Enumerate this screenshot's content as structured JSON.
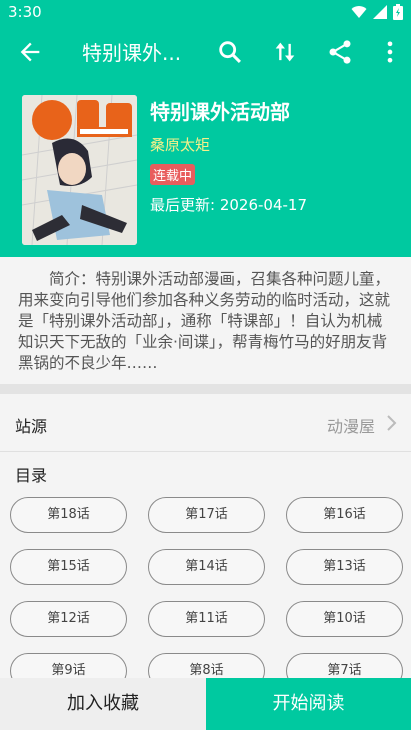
{
  "status_bar": {
    "time": "3:30"
  },
  "toolbar": {
    "title": "特别课外..."
  },
  "comic": {
    "title": "特别课外活动部",
    "author": "桑原太矩",
    "status": "连载中",
    "update_label": "最后更新:",
    "update_date": "2026-04-17",
    "intro": "简介：特别课外活动部漫画，召集各种问题儿童，用来变向引导他们参加各种义务劳动的临时活动，这就是「特别课外活动部」，通称「特课部」！自认为机械知识天下无敌的「业余·间谍」，帮青梅竹马的好朋友背黑锅的不良少年……"
  },
  "source": {
    "label": "站源",
    "value": "动漫屋"
  },
  "catalog": {
    "label": "目录",
    "chapters": [
      "第18话",
      "第17话",
      "第16话",
      "第15话",
      "第14话",
      "第13话",
      "第12话",
      "第11话",
      "第10话",
      "第9话",
      "第8话",
      "第7话"
    ]
  },
  "actions": {
    "favorite": "加入收藏",
    "read": "开始阅读"
  },
  "colors": {
    "accent": "#00c9a0",
    "author": "#f5f08a",
    "badge": "#e85d5d"
  },
  "icons": [
    "back-icon",
    "search-icon",
    "sort-icon",
    "share-icon",
    "more-icon",
    "wifi-icon",
    "signal-icon",
    "battery-icon",
    "chevron-right-icon"
  ]
}
